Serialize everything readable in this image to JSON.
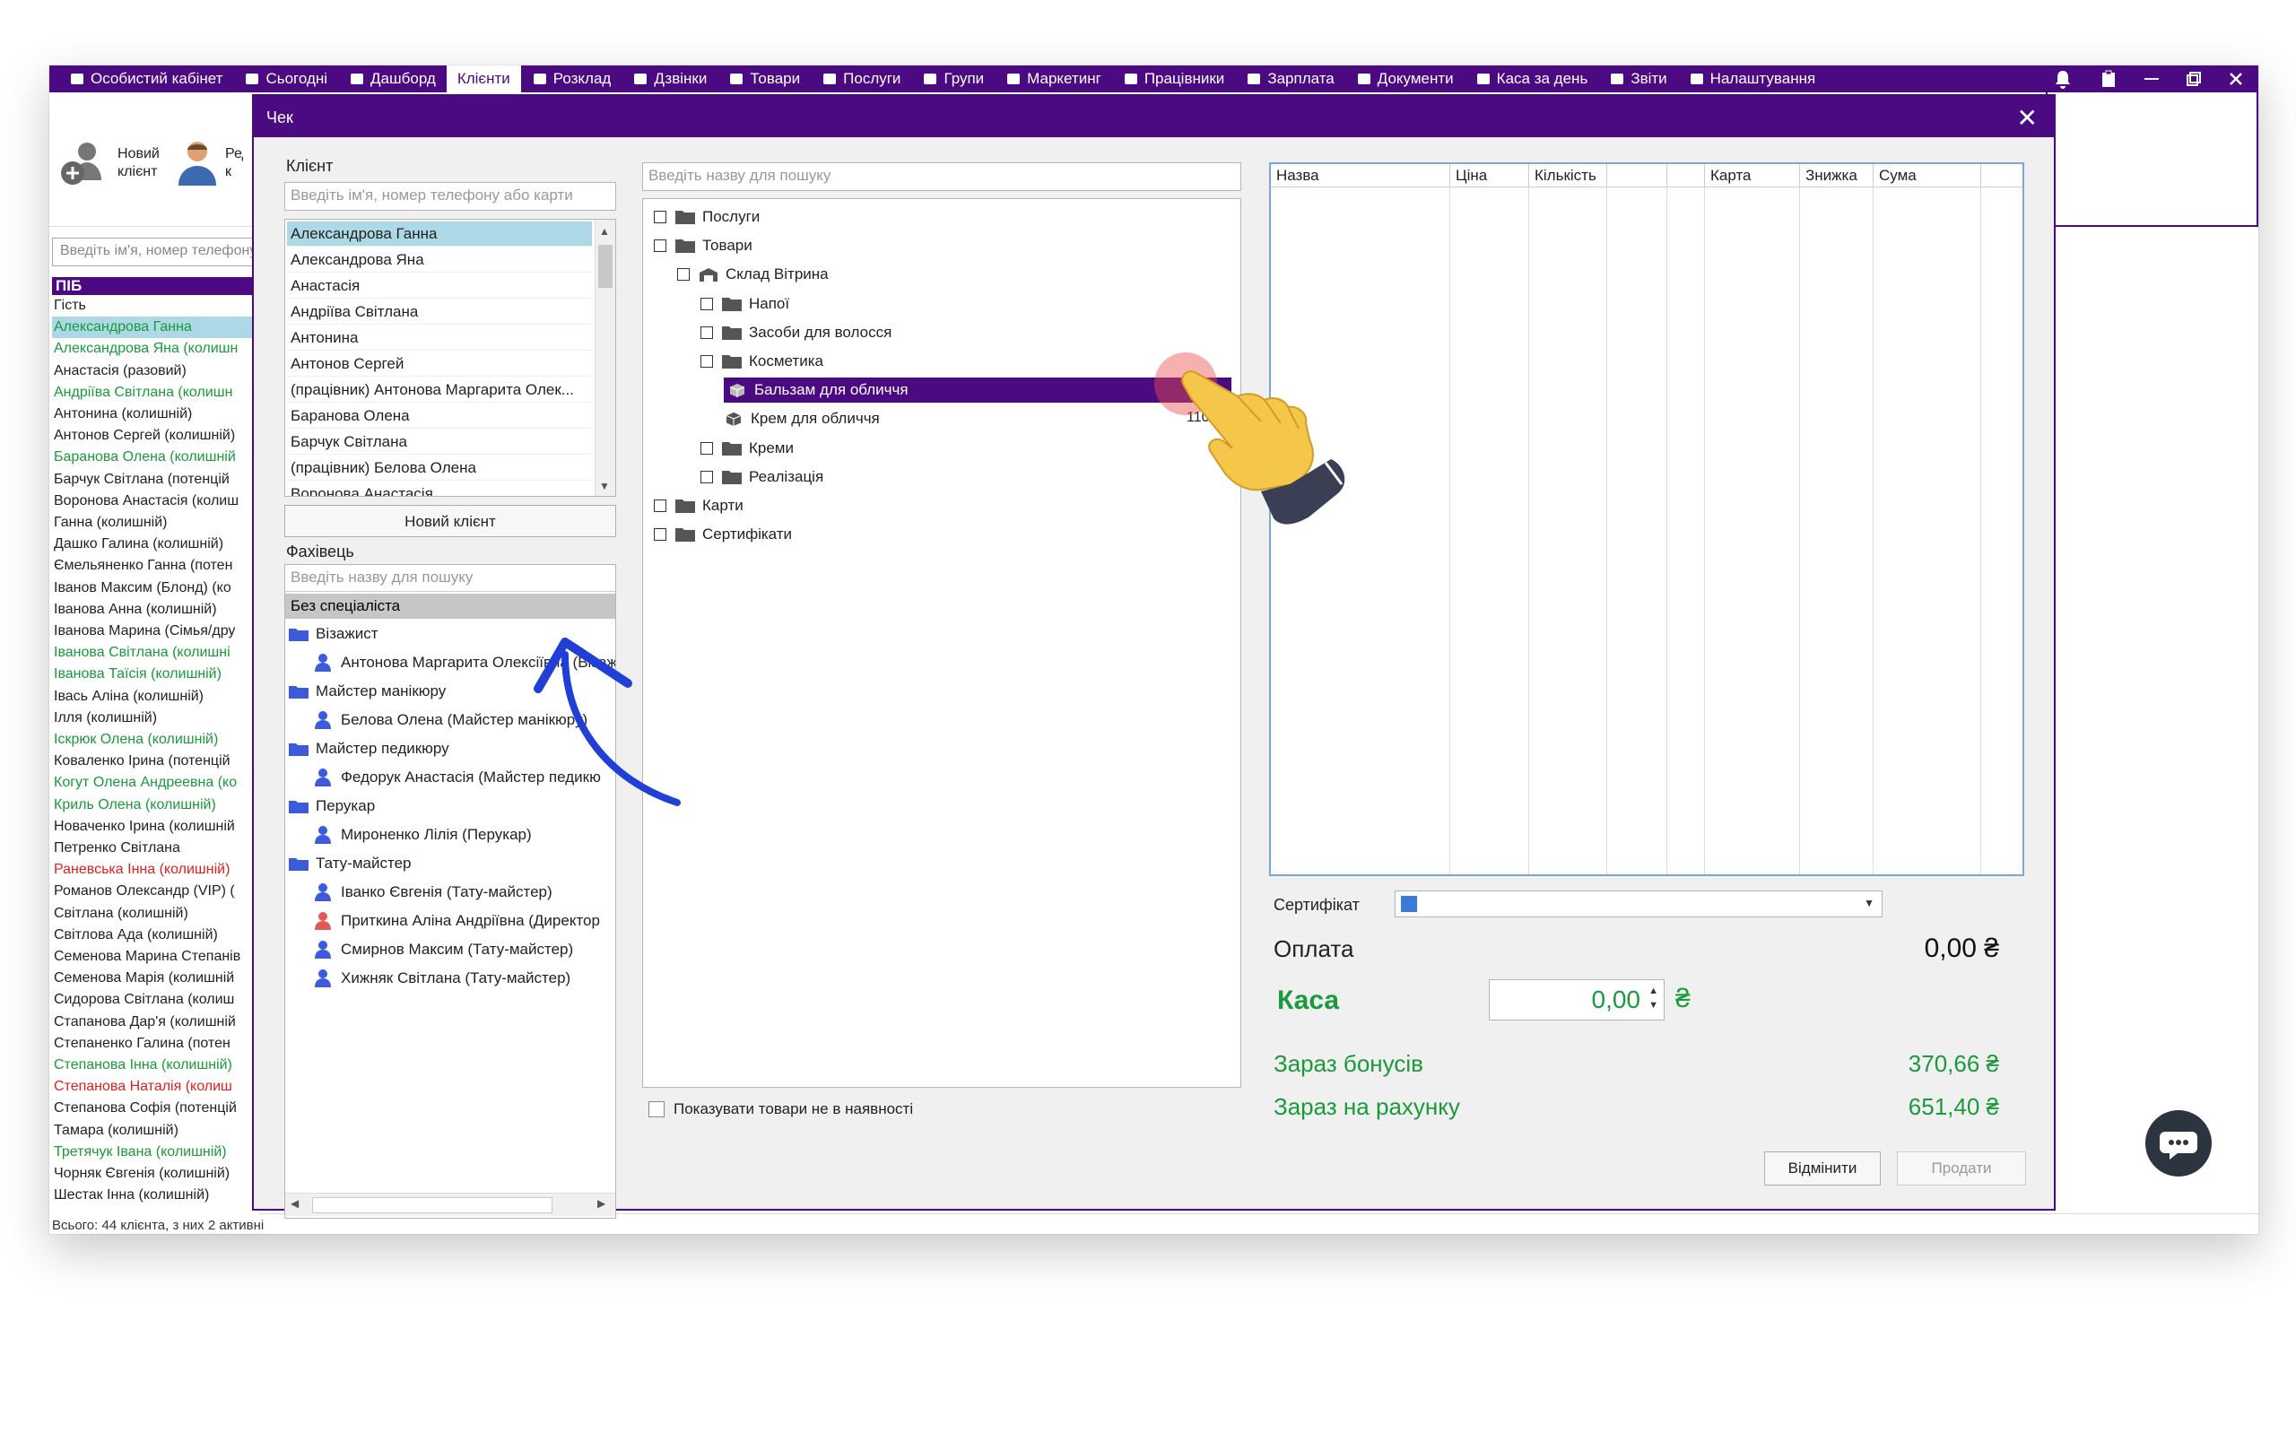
{
  "nav": {
    "items": [
      {
        "label": "Особистий кабінет",
        "icon": "briefcase-icon"
      },
      {
        "label": "Сьогодні",
        "icon": "clock-icon"
      },
      {
        "label": "Дашборд",
        "icon": "pulse-icon"
      },
      {
        "label": "Клієнти",
        "icon": "",
        "active": true
      },
      {
        "label": "Розклад",
        "icon": "calendar-icon"
      },
      {
        "label": "Дзвінки",
        "icon": "phone-icon"
      },
      {
        "label": "Товари",
        "icon": "box-icon"
      },
      {
        "label": "Послуги",
        "icon": "bolt-icon"
      },
      {
        "label": "Групи",
        "icon": "group-icon"
      },
      {
        "label": "Маркетинг",
        "icon": "megaphone-icon"
      },
      {
        "label": "Працівники",
        "icon": "user-icon"
      },
      {
        "label": "Зарплата",
        "icon": "money-icon"
      },
      {
        "label": "Документи",
        "icon": "document-icon"
      },
      {
        "label": "Каса за день",
        "icon": "calculator-icon"
      },
      {
        "label": "Звіти",
        "icon": "chart-icon"
      },
      {
        "label": "Налаштування",
        "icon": "gear-icon"
      }
    ]
  },
  "toolbar": {
    "new_client": "Новий клієнт",
    "edit_fragment": "Ред к"
  },
  "background": {
    "search_placeholder": "Введіть ім'я, номер телефону",
    "column_header": "ПІБ",
    "clients": [
      {
        "name": "Гість",
        "color": "#222222"
      },
      {
        "name": "Александрова Ганна",
        "color": "#1a9a3a"
      },
      {
        "name": "Александрова Яна (колишн",
        "color": "#1a9a3a"
      },
      {
        "name": "Анастасія (разовий)",
        "color": "#222222"
      },
      {
        "name": "Андріїва Світлана (колишн",
        "color": "#1a9a3a"
      },
      {
        "name": "Антонина (колишній)",
        "color": "#222222"
      },
      {
        "name": "Антонов Сергей (колишній)",
        "color": "#222222"
      },
      {
        "name": "Баранова Олена (колишній",
        "color": "#1a9a3a"
      },
      {
        "name": "Барчук Світлана (потенцій",
        "color": "#222222"
      },
      {
        "name": "Воронова Анастасія (колиш",
        "color": "#222222"
      },
      {
        "name": "Ганна (колишній)",
        "color": "#222222"
      },
      {
        "name": "Дашко Галина (колишній)",
        "color": "#222222"
      },
      {
        "name": "Ємельяненко Ганна (потен",
        "color": "#222222"
      },
      {
        "name": "Іванов Максим (Блонд) (ко",
        "color": "#222222"
      },
      {
        "name": "Іванова Анна (колишній)",
        "color": "#222222"
      },
      {
        "name": "Іванова Марина (Сімья/дру",
        "color": "#222222"
      },
      {
        "name": "Іванова Світлана (колишні",
        "color": "#1a9a3a"
      },
      {
        "name": "Іванова Таїсія (колишній)",
        "color": "#1a9a3a"
      },
      {
        "name": "Івась Аліна (колишній)",
        "color": "#222222"
      },
      {
        "name": "Ілля (колишній)",
        "color": "#222222"
      },
      {
        "name": "Іскрюк Олена (колишній)",
        "color": "#1a9a3a"
      },
      {
        "name": "Коваленко Ірина (потенцій",
        "color": "#222222"
      },
      {
        "name": "Когут Олена Андреевна (ко",
        "color": "#1a9a3a"
      },
      {
        "name": "Криль Олена (колишній)",
        "color": "#1a9a3a"
      },
      {
        "name": "Новаченко Ірина (колишній",
        "color": "#222222"
      },
      {
        "name": "Петренко Світлана",
        "color": "#222222"
      },
      {
        "name": "Раневська Інна (колишній)",
        "color": "#e02020"
      },
      {
        "name": "Романов Олександр (VIP) (",
        "color": "#222222"
      },
      {
        "name": "Світлана (колишній)",
        "color": "#222222"
      },
      {
        "name": "Світлова Ада (колишній)",
        "color": "#222222"
      },
      {
        "name": "Семенова Марина Степанів",
        "color": "#222222"
      },
      {
        "name": "Семенова Марія (колишній",
        "color": "#222222"
      },
      {
        "name": "Сидорова Світлана (колиш",
        "color": "#222222"
      },
      {
        "name": "Стапанова Дар'я (колишній",
        "color": "#222222"
      },
      {
        "name": "Степаненко Галина (потен",
        "color": "#222222"
      },
      {
        "name": "Степанова Інна (колишній)",
        "color": "#1a9a3a"
      },
      {
        "name": "Степанова Наталія (колиш",
        "color": "#e02020"
      },
      {
        "name": "Степанова Софія (потенцій",
        "color": "#222222"
      },
      {
        "name": "Тамара (колишній)",
        "color": "#222222"
      },
      {
        "name": "Третячук Івана (колишній)",
        "color": "#1a9a3a"
      },
      {
        "name": "Чорняк Євгенія (колишній)",
        "color": "#222222"
      },
      {
        "name": "Шестак Інна (колишній)",
        "color": "#222222"
      }
    ],
    "footer": "Всього: 44 клієнта, з них 2 активні"
  },
  "dialog": {
    "title": "Чек",
    "client_label": "Клієнт",
    "client_search_placeholder": "Введіть ім'я, номер телефону або карти",
    "client_list": [
      "Александрова Ганна",
      "Александрова Яна",
      "Анастасія",
      "Андріїва Світлана",
      "Антонина",
      "Антонов Сергей",
      "(працівник) Антонова Маргарита Олек...",
      "Баранова Олена",
      "Барчук Світлана",
      "(працівник) Белова Олена",
      "Воронова Анастасія"
    ],
    "new_client_button": "Новий клієнт",
    "specialist_label": "Фахівець",
    "specialist_search_placeholder": "Введіть назву для пошуку",
    "specialist_none": "Без спеціаліста",
    "specialist_groups": [
      {
        "group": "Візажист",
        "members": [
          "Антонова Маргарита Олексіївна (Візаж"
        ]
      },
      {
        "group": "Майстер манікюру",
        "members": [
          "Белова Олена (Майстер манікюру)"
        ]
      },
      {
        "group": "Майстер педикюру",
        "members": [
          "Федорук Анастасія (Майстер педикю"
        ]
      },
      {
        "group": "Перукар",
        "members": [
          "Мироненко Лілія (Перукар)"
        ]
      },
      {
        "group": "Тату-майстер",
        "members": [
          "Іванко Євгенія (Тату-майстер)",
          "Приткина Аліна Андріївна (Директор",
          "Смирнов Максим (Тату-майстер)",
          "Хижняк Світлана (Тату-майстер)"
        ]
      }
    ],
    "goods_search_placeholder": "Введіть назву для пошуку",
    "tree": [
      {
        "label": "Послуги",
        "type": "folder"
      },
      {
        "label": "Товари",
        "type": "folder"
      },
      {
        "label": "Склад Вітрина",
        "type": "warehouse"
      },
      {
        "label": "Напої",
        "type": "folder"
      },
      {
        "label": "Засоби для волосся",
        "type": "folder"
      },
      {
        "label": "Косметика",
        "type": "folder"
      },
      {
        "label": "Бальзам для обличчя",
        "type": "item",
        "selected": true
      },
      {
        "label": "Крем для обличчя",
        "type": "item",
        "price": "110,0"
      },
      {
        "label": "Креми",
        "type": "folder"
      },
      {
        "label": "Реалізація",
        "type": "folder"
      },
      {
        "label": "Карти",
        "type": "folder"
      },
      {
        "label": "Сертифікати",
        "type": "folder"
      }
    ],
    "show_out_of_stock": "Показувати товари не в наявності",
    "table_columns": [
      "Назва",
      "Ціна",
      "Кількість",
      "",
      "",
      "Карта",
      "Знижка",
      "Сума"
    ],
    "certificate_label": "Сертифікат",
    "payment_label": "Оплата",
    "payment_value": "0,00 ₴",
    "cash_label": "Каса",
    "cash_value": "0,00",
    "currency": "₴",
    "bonuses_label": "Зараз бонусів",
    "bonuses_value": "370,66 ₴",
    "account_label": "Зараз на рахунку",
    "account_value": "651,40 ₴",
    "cancel_button": "Відмінити",
    "sell_button": "Продати"
  },
  "colors": {
    "brand": "#4b0a82",
    "selected_row": "#add8e6",
    "positive": "#1a9a3a",
    "negative": "#e02020",
    "arrow": "#1f3fd6"
  }
}
